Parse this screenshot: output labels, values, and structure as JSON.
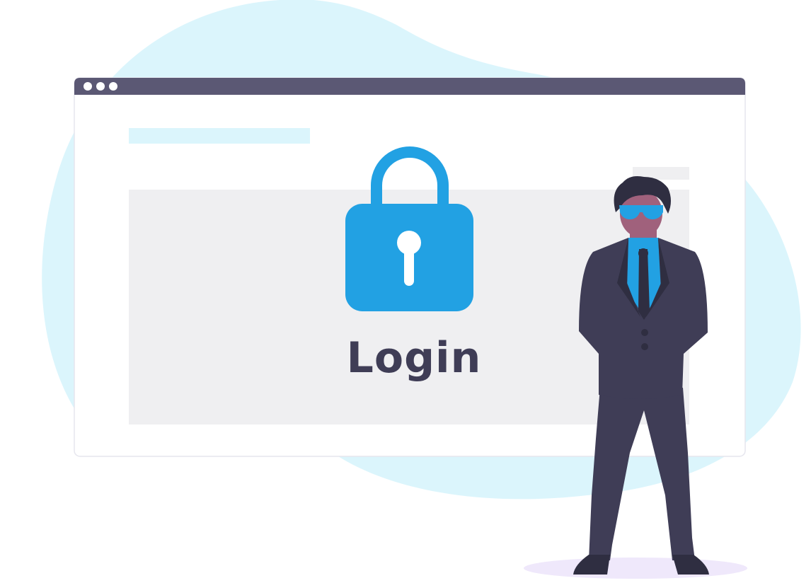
{
  "illustration": {
    "heading": "Login",
    "icons": {
      "window_controls": "three-dots-icon",
      "lock": "padlock-icon",
      "figure": "businessman-illustration"
    },
    "colors": {
      "background_blob": "#dbf5fc",
      "window_bar": "#5b5874",
      "window_body": "#ffffff",
      "content_panel": "#efeff1",
      "accent": "#22a1e3",
      "accent_light": "#dbf5fc",
      "text": "#3f3d56",
      "suit": "#3f3d56",
      "skin": "#a0617c",
      "shadow": "#efe8fb"
    }
  }
}
